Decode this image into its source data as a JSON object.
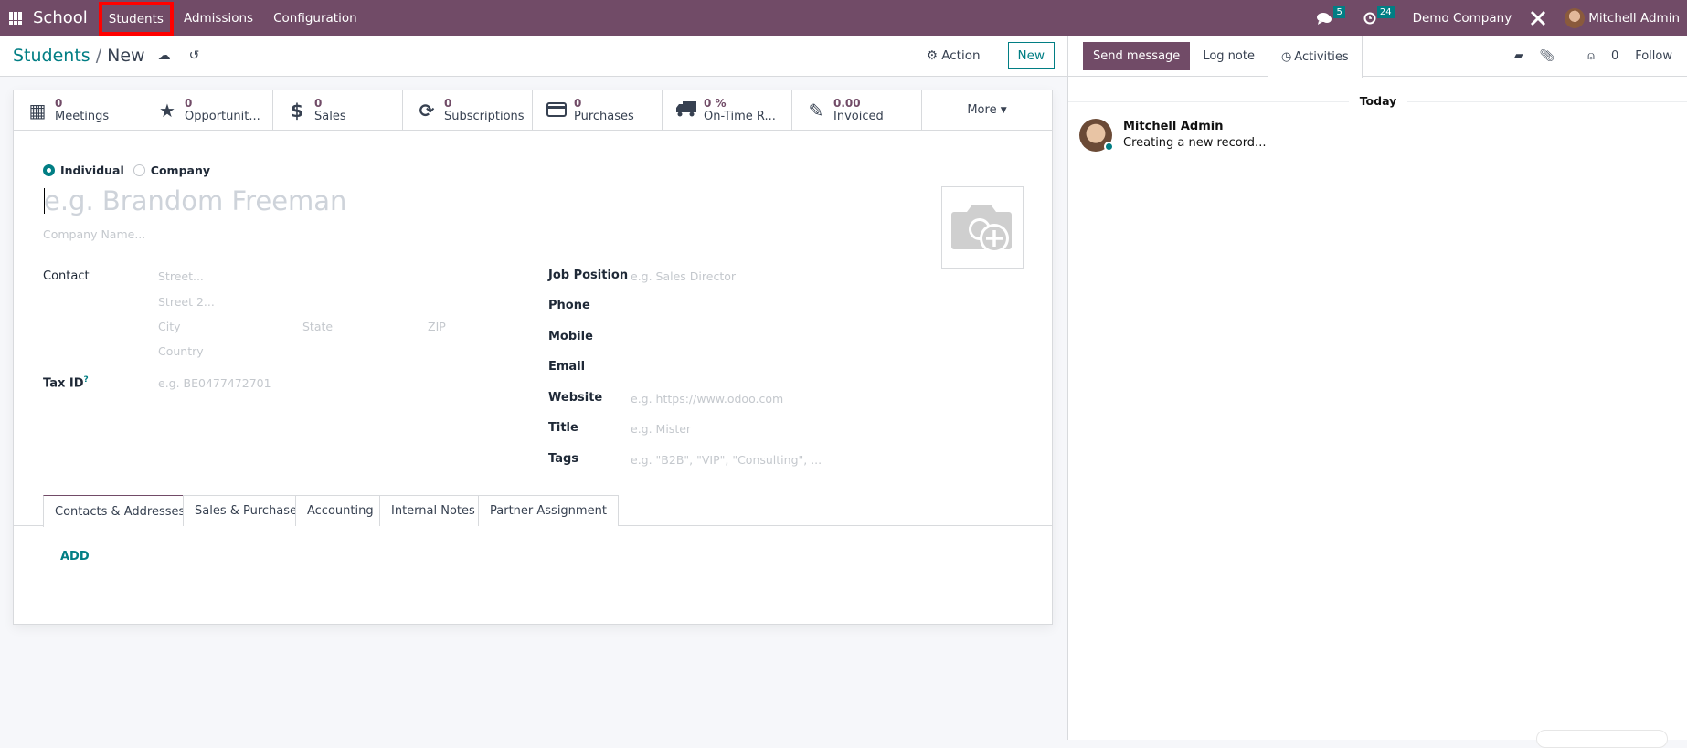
{
  "navbar": {
    "app_name": "School",
    "menu": [
      "Students",
      "Admissions",
      "Configuration"
    ],
    "messages_count": "5",
    "activities_count": "24",
    "company": "Demo Company",
    "user": "Mitchell Admin"
  },
  "breadcrumb": {
    "root": "Students",
    "separator": "/",
    "current": "New"
  },
  "control_panel": {
    "action_label": "Action",
    "new_label": "New"
  },
  "stat_buttons": [
    {
      "icon": "calendar-icon",
      "value": "0",
      "label": "Meetings"
    },
    {
      "icon": "star-icon",
      "value": "0",
      "label": "Opportunit..."
    },
    {
      "icon": "dollar-icon",
      "value": "0",
      "label": "Sales"
    },
    {
      "icon": "refresh-icon",
      "value": "0",
      "label": "Subscriptions"
    },
    {
      "icon": "credit-card-icon",
      "value": "0",
      "label": "Purchases"
    },
    {
      "icon": "truck-icon",
      "value": "0 %",
      "label": "On-Time R..."
    },
    {
      "icon": "edit-icon",
      "value": "0.00",
      "label": "Invoiced"
    }
  ],
  "more_label": "More",
  "form": {
    "type_options": [
      "Individual",
      "Company"
    ],
    "selected_type": "Individual",
    "name_placeholder": "e.g. Brandom Freeman",
    "company_placeholder": "Company Name...",
    "contact_label": "Contact",
    "street_placeholder": "Street...",
    "street2_placeholder": "Street 2...",
    "city_placeholder": "City",
    "state_placeholder": "State",
    "zip_placeholder": "ZIP",
    "country_placeholder": "Country",
    "taxid_label": "Tax ID",
    "taxid_help": "?",
    "taxid_placeholder": "e.g. BE0477472701",
    "job_label": "Job Position",
    "job_placeholder": "e.g. Sales Director",
    "phone_label": "Phone",
    "mobile_label": "Mobile",
    "email_label": "Email",
    "website_label": "Website",
    "website_placeholder": "e.g. https://www.odoo.com",
    "title_label": "Title",
    "title_placeholder": "e.g. Mister",
    "tags_label": "Tags",
    "tags_placeholder": "e.g. \"B2B\", \"VIP\", \"Consulting\", ..."
  },
  "tabs": [
    "Contacts & Addresses",
    "Sales & Purchase",
    "Accounting",
    "Internal Notes",
    "Partner Assignment"
  ],
  "active_tab": "Contacts & Addresses",
  "add_label": "ADD",
  "chatter": {
    "send_message": "Send message",
    "log_note": "Log note",
    "activities": "Activities",
    "followers_count": "0",
    "follow": "Follow",
    "date_separator": "Today",
    "messages": [
      {
        "author": "Mitchell Admin",
        "body": "Creating a new record..."
      }
    ]
  }
}
